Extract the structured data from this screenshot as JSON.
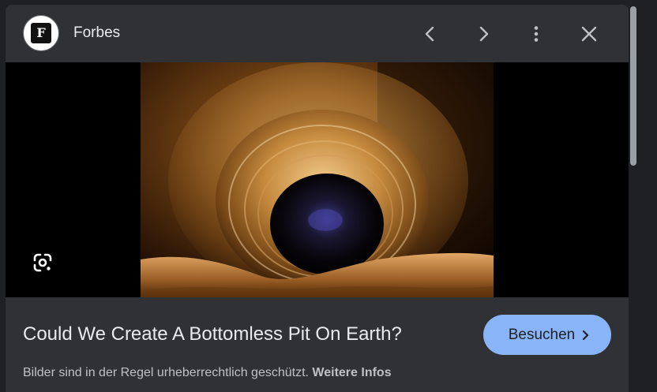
{
  "header": {
    "source_logo_letter": "F",
    "source_name": "Forbes",
    "prev_icon": "chevron-left-icon",
    "next_icon": "chevron-right-icon",
    "more_icon": "more-vert-icon",
    "close_icon": "close-icon"
  },
  "image": {
    "lens_icon": "google-lens-icon"
  },
  "result": {
    "title": "Could We Create A Bottomless Pit On Earth?",
    "visit_label": "Besuchen",
    "visit_icon": "chevron-right-icon",
    "copyright_text": "Bilder sind in der Regel urheberrechtlich geschützt.",
    "more_info_label": "Weitere Infos"
  },
  "colors": {
    "panel_bg": "#303134",
    "image_bg": "#000000",
    "accent": "#8ab4f8",
    "text_primary": "#e8eaed",
    "text_secondary": "#bdc1c6"
  }
}
